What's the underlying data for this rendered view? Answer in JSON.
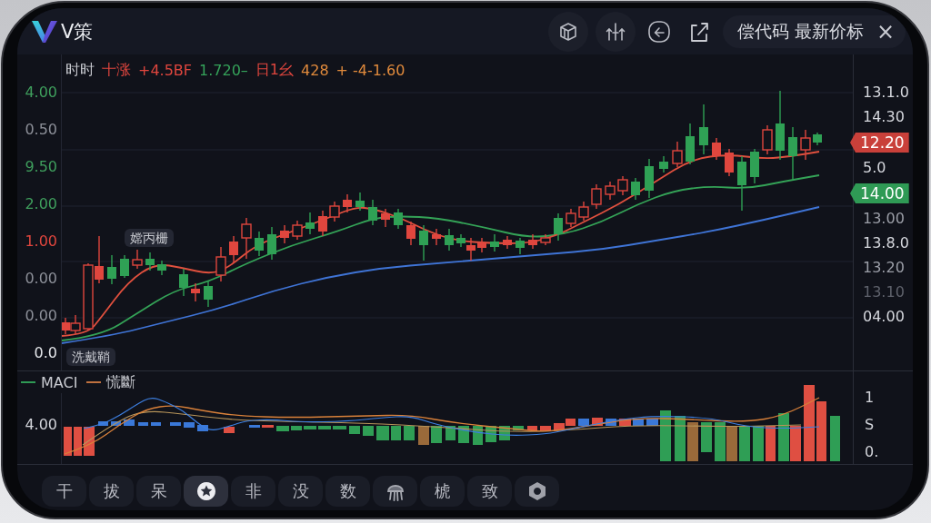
{
  "app_bar": {
    "title": "V策",
    "search_chip": {
      "text": "偿代码 最新价标",
      "close": "×"
    }
  },
  "quote_line": [
    {
      "text": "时时",
      "color": "#c9cbd1"
    },
    {
      "text": "十涨",
      "color": "#e0463e"
    },
    {
      "text": "+4.5BF",
      "color": "#e0463e"
    },
    {
      "text": "1.720–",
      "color": "#35a35a"
    },
    {
      "text": "日1幺",
      "color": "#e0463e"
    },
    {
      "text": "428",
      "color": "#e08a3c"
    },
    {
      "text": "+ -4-1.60",
      "color": "#e08a3c"
    }
  ],
  "price_chart": {
    "left_axis": [
      {
        "label": "4.00",
        "color": "#3f9f5d"
      },
      {
        "label": "0.50",
        "color": "#8d9099"
      },
      {
        "label": "9.50",
        "color": "#3f9f5d"
      },
      {
        "label": "2.00",
        "color": "#3f9f5d"
      },
      {
        "label": "1.00",
        "color": "#e0463e"
      },
      {
        "label": "0.00",
        "color": "#8d9099"
      },
      {
        "label": "0.00",
        "color": "#8d9099"
      },
      {
        "label": "0.0",
        "color": "#e4e6ea"
      }
    ],
    "right_axis": [
      {
        "label": "13.1.0",
        "kind": "tick",
        "color": "#d6d8de"
      },
      {
        "label": "14.30",
        "kind": "tick",
        "color": "#d6d8de"
      },
      {
        "label": "12.20",
        "kind": "badge",
        "color": "#c9403a"
      },
      {
        "label": "5.0",
        "kind": "tick",
        "color": "#d6d8de"
      },
      {
        "label": "14.00",
        "kind": "badge",
        "color": "#2f9a55"
      },
      {
        "label": "13.00",
        "kind": "tick",
        "color": "#9c9fa8"
      },
      {
        "label": "13.8.0",
        "kind": "tick",
        "color": "#d6d8de"
      },
      {
        "label": "13.20",
        "kind": "tick",
        "color": "#9c9fa8"
      },
      {
        "label": "13.10",
        "kind": "tick",
        "color": "#5f626c"
      },
      {
        "label": "04.00",
        "kind": "tick",
        "color": "#d6d8de"
      }
    ],
    "annotations": [
      {
        "text": "嫦丙栅"
      },
      {
        "text": "洗戴鞘"
      }
    ]
  },
  "indicator_panel": {
    "legend": [
      {
        "label": "MACI",
        "color": "#2f9a55"
      },
      {
        "label": "慌斷",
        "color": "#c0713f"
      }
    ],
    "left_axis": [
      "4.00"
    ],
    "right_axis": [
      "1",
      "S",
      "0."
    ]
  },
  "toolbar": [
    {
      "kind": "text",
      "label": "干",
      "selected": false
    },
    {
      "kind": "text",
      "label": "拔",
      "selected": false
    },
    {
      "kind": "text",
      "label": "呆",
      "selected": false
    },
    {
      "kind": "badge",
      "selected": true
    },
    {
      "kind": "text",
      "label": "非",
      "selected": false
    },
    {
      "kind": "text",
      "label": "没",
      "selected": false
    },
    {
      "kind": "text",
      "label": "数",
      "selected": false
    },
    {
      "kind": "glyph",
      "selected": false
    },
    {
      "kind": "text",
      "label": "椃",
      "selected": false
    },
    {
      "kind": "text",
      "label": "致",
      "selected": false
    },
    {
      "kind": "home",
      "selected": false
    }
  ]
}
